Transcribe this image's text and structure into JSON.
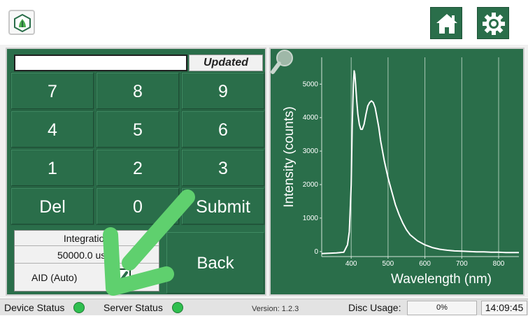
{
  "topbar": {
    "logo_icon": "app-logo-icon",
    "home_icon": "home-icon",
    "settings_icon": "gear-icon",
    "accent_color": "#2a6e4a"
  },
  "keypad": {
    "entry_value": "",
    "updated_label": "Updated",
    "keys": [
      "7",
      "8",
      "9",
      "4",
      "5",
      "6",
      "1",
      "2",
      "3",
      "Del",
      "0",
      "Submit"
    ],
    "back_label": "Back"
  },
  "integration": {
    "title": "Integration",
    "value": "50000.0 usec",
    "aid_label": "AID (Auto)",
    "aid_checked": true
  },
  "overlay": {
    "arrow_color": "#5fd06e",
    "arrow_icon": "down-left-arrow-icon"
  },
  "chart_data": {
    "type": "line",
    "xlabel": "Wavelength (nm)",
    "ylabel": "Intensity (counts)",
    "xlim": [
      320,
      855
    ],
    "ylim": [
      -150,
      5800
    ],
    "xticks": [
      400,
      500,
      600,
      700,
      800
    ],
    "yticks": [
      0,
      1000,
      2000,
      3000,
      4000,
      5000
    ],
    "grid": "vertical",
    "series": [
      {
        "x": [
          320,
          340,
          360,
          380,
          390,
          395,
          400,
          403,
          406,
          408,
          410,
          412,
          415,
          418,
          422,
          426,
          430,
          435,
          440,
          445,
          450,
          455,
          460,
          465,
          470,
          475,
          480,
          490,
          500,
          510,
          520,
          530,
          540,
          550,
          560,
          580,
          600,
          620,
          640,
          660,
          680,
          700,
          720,
          740,
          760,
          780,
          800,
          820,
          840,
          855
        ],
        "y": [
          -60,
          -50,
          -40,
          -20,
          200,
          600,
          2000,
          3800,
          5000,
          5400,
          5300,
          5000,
          4500,
          4100,
          3800,
          3650,
          3650,
          3800,
          4100,
          4350,
          4450,
          4500,
          4450,
          4300,
          4000,
          3700,
          3300,
          2700,
          2200,
          1800,
          1400,
          1100,
          850,
          650,
          500,
          320,
          200,
          120,
          70,
          40,
          20,
          10,
          0,
          -10,
          -10,
          -20,
          -20,
          -30,
          -30,
          -30
        ]
      }
    ]
  },
  "status": {
    "device_label": "Device Status",
    "server_label": "Server Status",
    "device_color": "#2fbf4f",
    "server_color": "#2fbf4f",
    "version": "Version: 1.2.3",
    "disc_label": "Disc Usage:",
    "disc_value": "0%",
    "time": "14:09:45"
  },
  "zoom_icon": "zoom-magnifier-icon"
}
